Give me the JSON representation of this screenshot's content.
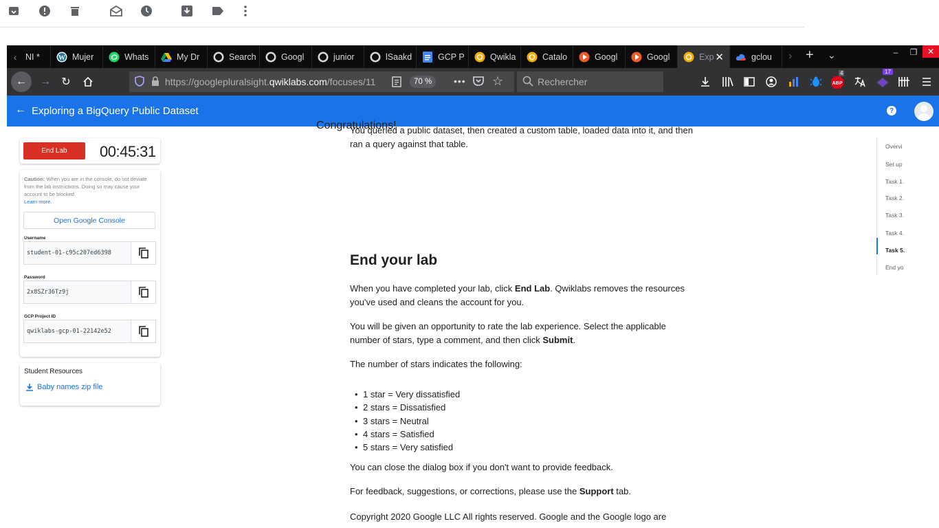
{
  "browser": {
    "tabs": [
      {
        "label": "NI *",
        "icon": "tab-scroll-left-icon"
      },
      {
        "label": "Mujer",
        "icon": "wordpress-icon"
      },
      {
        "label": "Whats",
        "icon": "whatsapp-icon"
      },
      {
        "label": "My Dr",
        "icon": "google-drive-icon"
      },
      {
        "label": "Search",
        "icon": "github-icon"
      },
      {
        "label": "Googl",
        "icon": "github-icon"
      },
      {
        "label": "junior",
        "icon": "github-icon"
      },
      {
        "label": "lSaakd",
        "icon": "github-icon"
      },
      {
        "label": "GCP P",
        "icon": "google-docs-icon"
      },
      {
        "label": "Qwikla",
        "icon": "qwiklabs-icon"
      },
      {
        "label": "Catalo",
        "icon": "qwiklabs-icon"
      },
      {
        "label": "Googl",
        "icon": "pluralsight-icon"
      },
      {
        "label": "Googl",
        "icon": "pluralsight-icon"
      },
      {
        "label": "Exp",
        "icon": "qwiklabs-icon"
      },
      {
        "label": "gclou",
        "icon": "google-cloud-icon"
      }
    ],
    "url_prefix": "https://googlepluralsight.",
    "url_host": "qwiklabs.com",
    "url_path": "/focuses/11",
    "zoom": "70 %",
    "search_placeholder": "Rechercher",
    "badge_abp": "4",
    "badge_ext": "17"
  },
  "app": {
    "title": "Exploring a BigQuery Public Dataset",
    "end_lab": "End Lab",
    "timer": "00:45:31",
    "caution_bold": "Caution:",
    "caution_text": " When you are in the console, do not deviate from the lab instructions. Doing so may cause your account to be blocked.",
    "learn_more": "Learn more.",
    "open_console": "Open Google Console",
    "credentials": {
      "username_label": "Username",
      "username": "student-01-c95c207ed6398",
      "password_label": "Password",
      "password": "2x8SZr36Tz9j",
      "project_label": "GCP Project ID",
      "project": "qwiklabs-gcp-01-22142e52"
    },
    "resources_title": "Student Resources",
    "resources_link": "Baby names zip file"
  },
  "content": {
    "congrats": "Congratulations!",
    "summary": "You queried a public dataset, then created a custom table, loaded data into it, and then ran a query against that table.",
    "heading": "End your lab",
    "p1_a": "When you have completed your lab, click ",
    "p1_b": "End Lab",
    "p1_c": ". Qwiklabs removes the resources you've used and cleans the account for you.",
    "p2_a": "You will be given an opportunity to rate the lab experience. Select the applicable number of stars, type a comment, and then click ",
    "p2_b": "Submit",
    "p2_c": ".",
    "p3": "The number of stars indicates the following:",
    "stars": [
      "1 star = Very dissatisfied",
      "2 stars = Dissatisfied",
      "3 stars = Neutral",
      "4 stars = Satisfied",
      "5 stars = Very satisfied"
    ],
    "p4": "You can close the dialog box if you don't want to provide feedback.",
    "p5_a": "For feedback, suggestions, or corrections, please use the ",
    "p5_b": "Support",
    "p5_c": " tab.",
    "p6": "Copyright 2020 Google LLC All rights reserved. Google and the Google logo are"
  },
  "toc": [
    "Overvi",
    "Set up",
    "Task 1.",
    "Task 2.",
    "Task 3.",
    "Task 4.",
    "Task 5.",
    "End yo"
  ],
  "colors": {
    "accent": "#1a73e8",
    "end_lab": "#d93025",
    "browser_dark": "#0c0c0d"
  }
}
